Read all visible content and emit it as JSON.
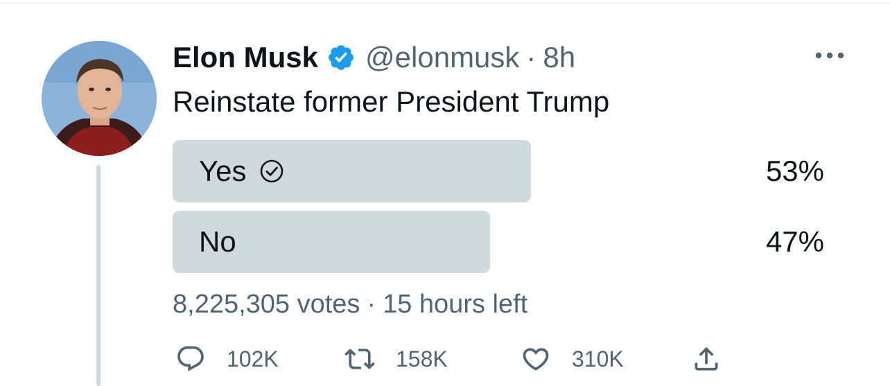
{
  "tweet": {
    "author": {
      "display_name": "Elon Musk",
      "handle": "@elonmusk",
      "verified_icon": "verified-badge-icon",
      "avatar_icon": "avatar-photo"
    },
    "separator": "·",
    "time": "8h",
    "text": "Reinstate former President Trump",
    "more_icon": "more-horizontal-icon"
  },
  "poll": {
    "options": [
      {
        "label": "Yes",
        "percent_text": "53%",
        "percent": 53,
        "winner": true
      },
      {
        "label": "No",
        "percent_text": "47%",
        "percent": 47,
        "winner": false
      }
    ],
    "votes": "8,225,305 votes",
    "separator": "·",
    "time_left": "15 hours left"
  },
  "actions": {
    "reply": {
      "icon": "reply-icon",
      "count": "102K"
    },
    "retweet": {
      "icon": "retweet-icon",
      "count": "158K"
    },
    "like": {
      "icon": "heart-icon",
      "count": "310K"
    },
    "share": {
      "icon": "share-icon"
    }
  },
  "colors": {
    "text_primary": "#0f1419",
    "text_secondary": "#536471",
    "poll_fill": "#cfd9de",
    "verified_blue": "#1d9bf0"
  }
}
